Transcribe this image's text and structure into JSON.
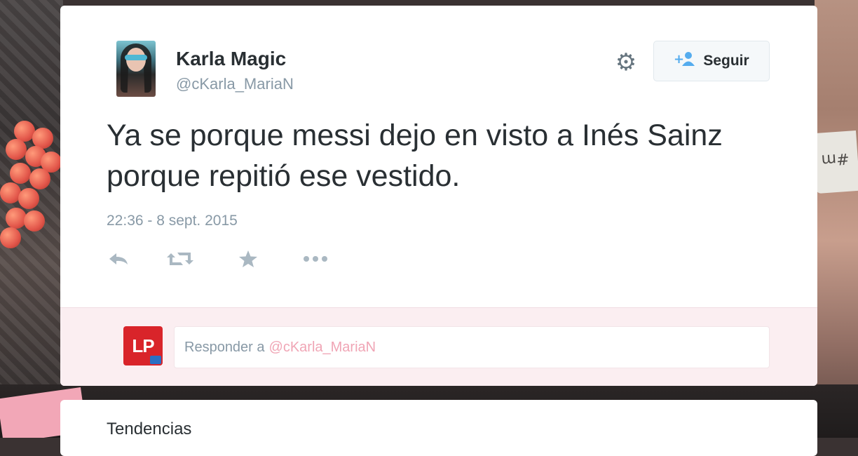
{
  "tweet": {
    "author_name": "Karla Magic",
    "author_handle": "@cKarla_MariaN",
    "text": "Ya se porque messi dejo en visto a Inés Sainz porque repitió ese vestido.",
    "timestamp": "22:36 - 8 sept. 2015",
    "follow_label": "Seguir",
    "actions": [
      {
        "name": "reply-icon",
        "glyph": "↩"
      },
      {
        "name": "retweet-icon",
        "glyph": "⇄"
      },
      {
        "name": "favorite-star-icon",
        "glyph": "★"
      },
      {
        "name": "more-icon",
        "glyph": "•••"
      }
    ]
  },
  "reply": {
    "logo_text": "LP",
    "placeholder_prefix": "Responder a",
    "placeholder_mention": "@cKarla_MariaN"
  },
  "background": {
    "band_text": "#m"
  },
  "trends": {
    "title": "Tendencias"
  },
  "colors": {
    "accent": "#55acee",
    "text": "#292f33",
    "muted": "#8899a6",
    "reply_bg": "#fbeef1",
    "logo_red": "#d9242a"
  }
}
